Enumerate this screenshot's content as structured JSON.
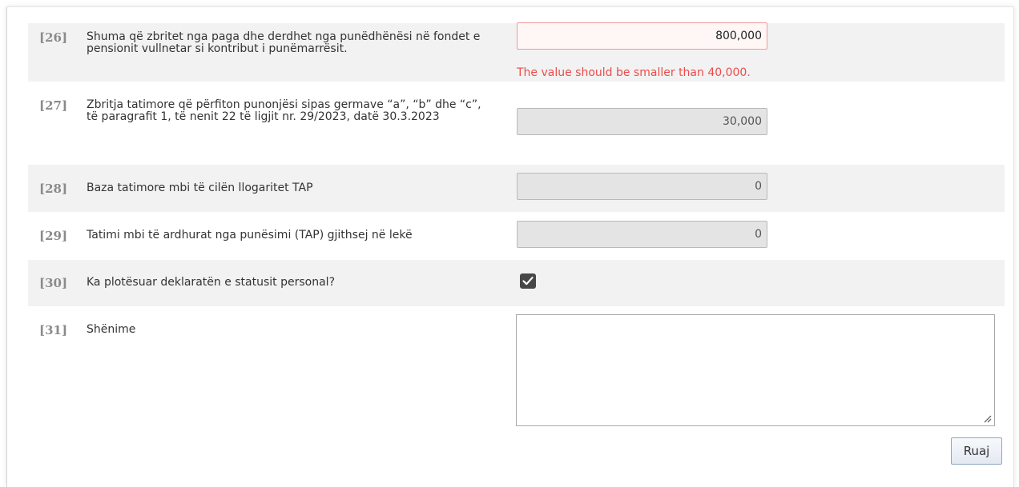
{
  "rows": [
    {
      "number": "[26]",
      "label": "Shuma që zbritet nga paga dhe derdhet nga punëdhënësi në fondet e pensionit vullnetar si kontribut i punëmarrësit.",
      "value": "800,000",
      "error": "The value should be smaller than 40,000."
    },
    {
      "number": "[27]",
      "label": "Zbritja tatimore që përfiton punonjësi sipas germave “a”, “b” dhe “c”, të paragrafit 1, të nenit 22 të ligjit nr. 29/2023, datë 30.3.2023",
      "value": "30,000"
    },
    {
      "number": "[28]",
      "label": "Baza tatimore mbi të cilën llogaritet TAP",
      "value": "0"
    },
    {
      "number": "[29]",
      "label": "Tatimi mbi të ardhurat nga punësimi (TAP) gjithsej në lekë",
      "value": "0"
    },
    {
      "number": "[30]",
      "label": "Ka plotësuar deklaratën e statusit personal?",
      "checked": true
    },
    {
      "number": "[31]",
      "label": "Shënime",
      "value": ""
    }
  ],
  "save_label": "Ruaj",
  "colors": {
    "error_text": "#ec4b4b",
    "error_border": "#f19999",
    "row_shade": "#f2f2f2",
    "readonly_field": "#e4e4e4"
  }
}
